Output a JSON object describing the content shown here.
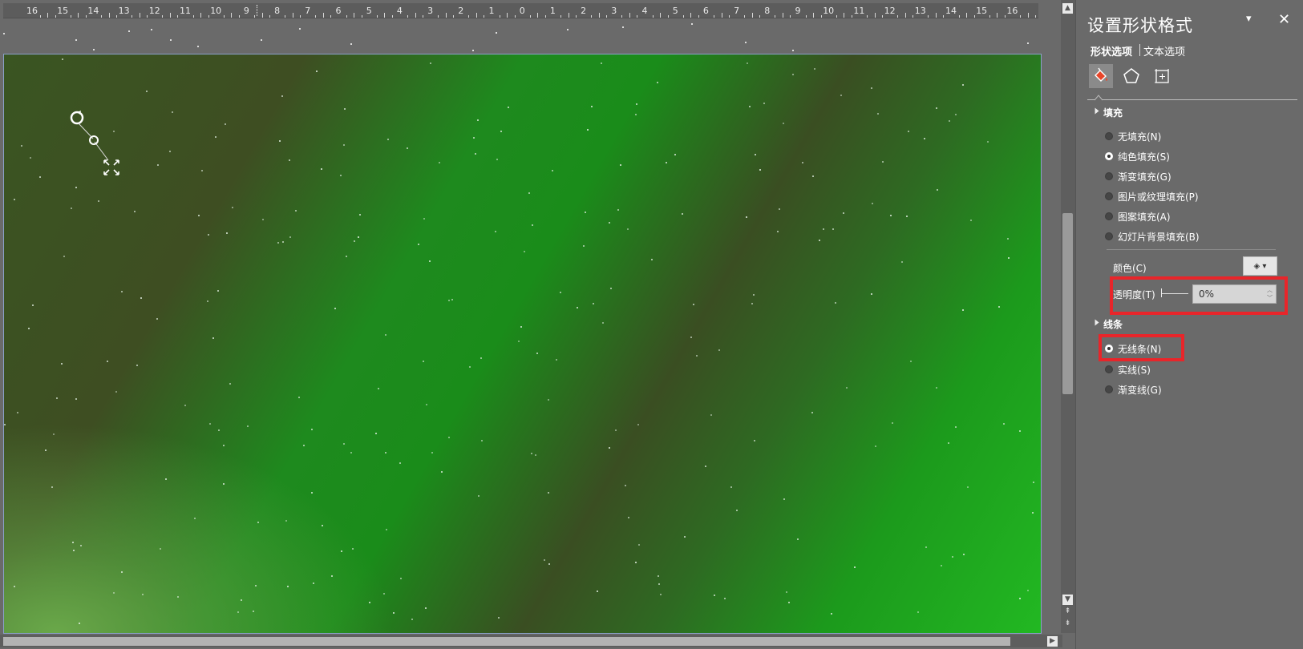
{
  "ruler": {
    "labels": [
      "16",
      "15",
      "14",
      "13",
      "12",
      "11",
      "10",
      "9",
      "8",
      "7",
      "6",
      "5",
      "4",
      "3",
      "2",
      "1",
      "0",
      "1",
      "2",
      "3",
      "4",
      "5",
      "6",
      "7",
      "8",
      "9",
      "10",
      "11",
      "12",
      "13",
      "14",
      "15",
      "16"
    ]
  },
  "panel": {
    "title": "设置形状格式",
    "menu_icon": "▾",
    "close_icon": "✕",
    "tabs": {
      "shape_options": "形状选项",
      "text_options": "文本选项"
    },
    "icons": {
      "fill_line": "paint-bucket-icon",
      "effects": "pentagon-icon",
      "size_properties": "size-layout-icon"
    },
    "fill_section": {
      "title": "填充",
      "options": [
        {
          "label": "无填充(N)",
          "selected": false
        },
        {
          "label": "纯色填充(S)",
          "selected": true
        },
        {
          "label": "渐变填充(G)",
          "selected": false
        },
        {
          "label": "图片或纹理填充(P)",
          "selected": false
        },
        {
          "label": "图案填充(A)",
          "selected": false
        },
        {
          "label": "幻灯片背景填充(B)",
          "selected": false
        }
      ],
      "color_label": "颜色(C)",
      "transparency_label": "透明度(T)",
      "transparency_value": "0%"
    },
    "line_section": {
      "title": "线条",
      "options": [
        {
          "label": "无线条(N)",
          "selected": true
        },
        {
          "label": "实线(S)",
          "selected": false
        },
        {
          "label": "渐变线(G)",
          "selected": false
        }
      ]
    }
  },
  "colors": {
    "highlight": "#e8252a",
    "slide_green": "#1a8c1a",
    "panel_bg": "#6a6a6a"
  }
}
